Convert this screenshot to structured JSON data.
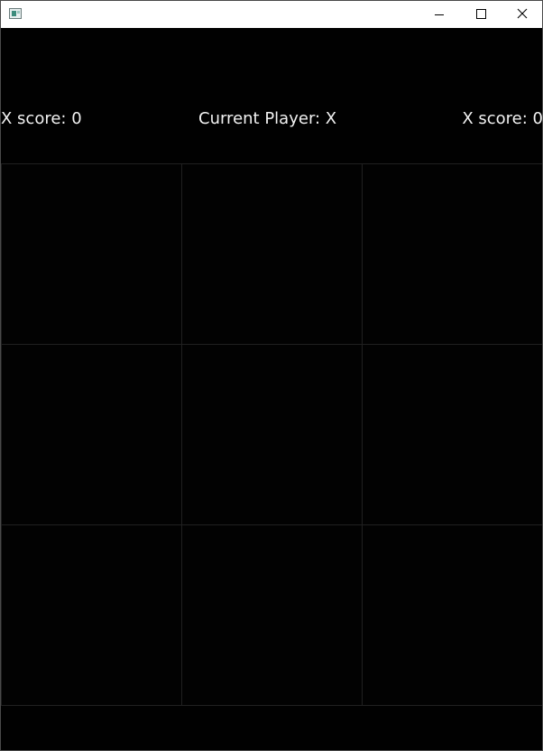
{
  "titlebar": {
    "icon": "app-window-icon",
    "controls": {
      "minimize": "minimize-icon",
      "maximize": "maximize-icon",
      "close": "close-icon"
    }
  },
  "game": {
    "left_score": "X score: 0",
    "current_player": "Current Player: X",
    "right_score": "X score: 0",
    "board": {
      "rows": 3,
      "cols": 3,
      "cells": [
        "",
        "",
        "",
        "",
        "",
        "",
        "",
        "",
        ""
      ]
    }
  },
  "colors": {
    "background": "#010101",
    "grid_line": "#202020",
    "text": "#f2f2f2",
    "titlebar": "#ffffff"
  }
}
